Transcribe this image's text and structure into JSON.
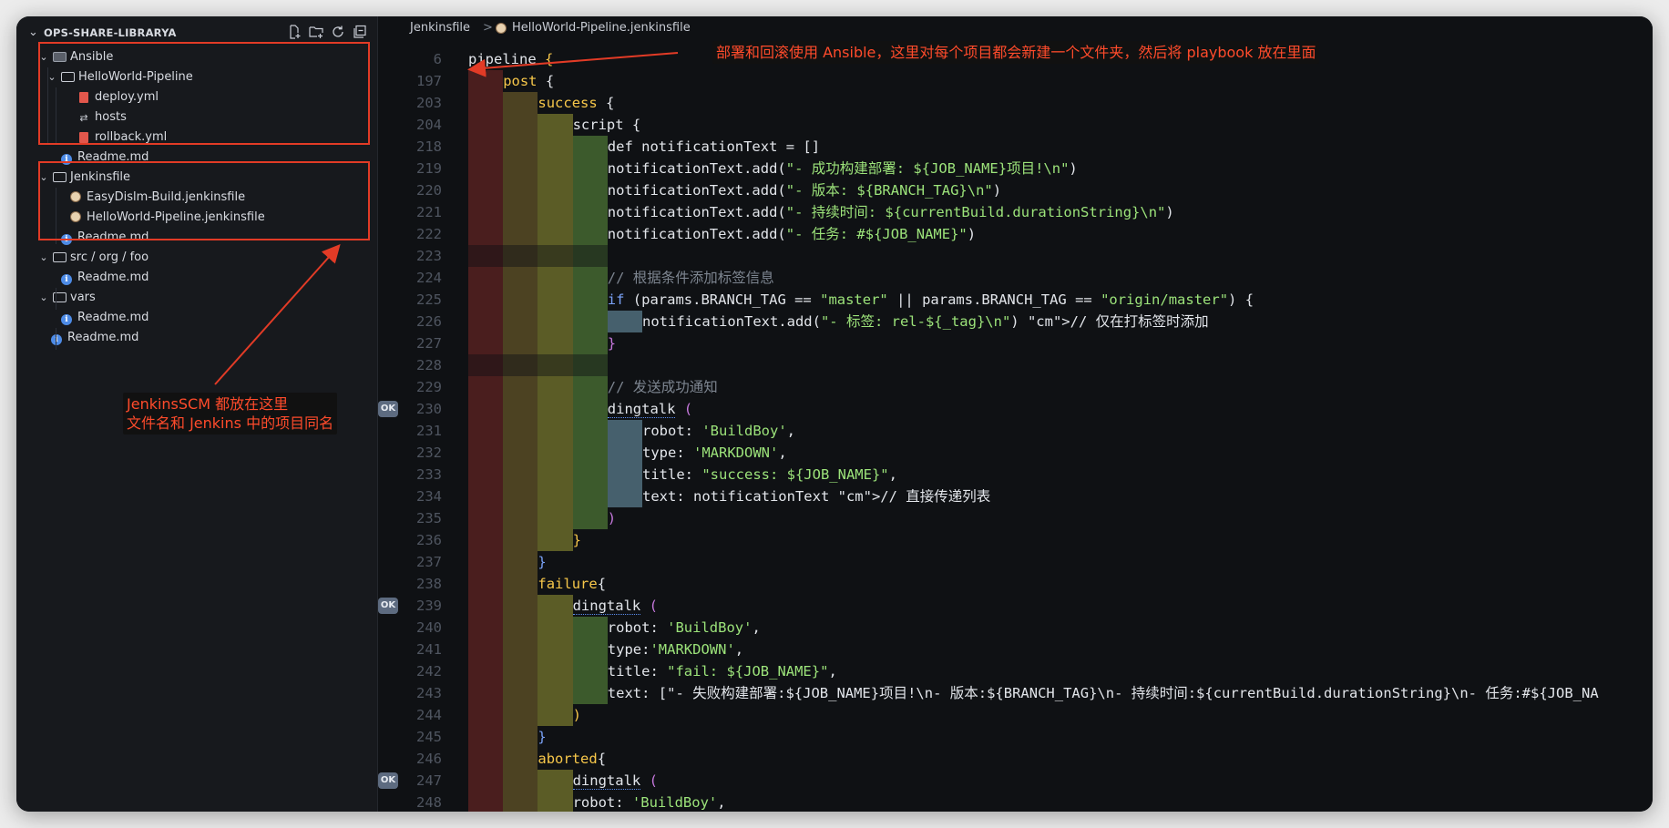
{
  "sidebar": {
    "title": "OPS-SHARE-LIBRARYA",
    "items": [
      {
        "label": "Ansible",
        "depth": 0,
        "kind": "folder-ansible",
        "expanded": true
      },
      {
        "label": "HelloWorld-Pipeline",
        "depth": 1,
        "kind": "folder",
        "expanded": true
      },
      {
        "label": "deploy.yml",
        "depth": 2,
        "kind": "yml"
      },
      {
        "label": "hosts",
        "depth": 2,
        "kind": "hosts"
      },
      {
        "label": "rollback.yml",
        "depth": 2,
        "kind": "yml"
      },
      {
        "label": "Readme.md",
        "depth": 1,
        "kind": "info"
      },
      {
        "label": "Jenkinsfile",
        "depth": 0,
        "kind": "folder",
        "expanded": true
      },
      {
        "label": "EasyDislm-Build.jenkinsfile",
        "depth": 1,
        "kind": "jenkins"
      },
      {
        "label": "HelloWorld-Pipeline.jenkinsfile",
        "depth": 1,
        "kind": "jenkins"
      },
      {
        "label": "Readme.md",
        "depth": 1,
        "kind": "info"
      },
      {
        "label": "src / org / foo",
        "depth": 0,
        "kind": "folder",
        "expanded": true
      },
      {
        "label": "Readme.md",
        "depth": 1,
        "kind": "info"
      },
      {
        "label": "vars",
        "depth": 0,
        "kind": "folder",
        "expanded": true
      },
      {
        "label": "Readme.md",
        "depth": 1,
        "kind": "info"
      },
      {
        "label": "Readme.md",
        "depth": 0,
        "kind": "info"
      }
    ]
  },
  "breadcrumb": {
    "folder": "Jenkinsfile",
    "separator": ">",
    "file": "HelloWorld-Pipeline.jenkinsfile"
  },
  "annotations": {
    "top": "部署和回滚使用 Ansible，这里对每个项目都会新建一个文件夹，然后将 playbook 放在里面",
    "left_line1": "JenkinsSCM 都放在这里",
    "left_line2": "文件名和 Jenkins 中的项目同名",
    "color": "#e23b26"
  },
  "code": {
    "ok_label": "OK",
    "lines": [
      {
        "n": "6",
        "indent": 0,
        "t": "pipeline {",
        "cls": "pipeline"
      },
      {
        "n": "197",
        "indent": 1,
        "t": "post {",
        "cls": "kw"
      },
      {
        "n": "203",
        "indent": 2,
        "t": "success {",
        "cls": "kw"
      },
      {
        "n": "204",
        "indent": 3,
        "t": "script {",
        "cls": "plain"
      },
      {
        "n": "218",
        "indent": 4,
        "t": "def notificationText = []",
        "cls": "plain"
      },
      {
        "n": "219",
        "indent": 4,
        "t": "notificationText.add(\"- 成功构建部署: ${JOB_NAME}项目!\\n\")",
        "cls": "add"
      },
      {
        "n": "220",
        "indent": 4,
        "t": "notificationText.add(\"- 版本: ${BRANCH_TAG}\\n\")",
        "cls": "add"
      },
      {
        "n": "221",
        "indent": 4,
        "t": "notificationText.add(\"- 持续时间: ${currentBuild.durationString}\\n\")",
        "cls": "add"
      },
      {
        "n": "222",
        "indent": 4,
        "t": "notificationText.add(\"- 任务: #${JOB_NAME}\")",
        "cls": "add"
      },
      {
        "n": "223",
        "indent": 4,
        "t": "",
        "cls": "plain"
      },
      {
        "n": "224",
        "indent": 4,
        "t": "// 根据条件添加标签信息",
        "cls": "cm"
      },
      {
        "n": "225",
        "indent": 4,
        "t": "if (params.BRANCH_TAG == \"master\" || params.BRANCH_TAG == \"origin/master\") {",
        "cls": "if"
      },
      {
        "n": "226",
        "indent": 5,
        "t": "notificationText.add(\"- 标签: rel-${_tag}\\n\") // 仅在打标签时添加",
        "cls": "tag"
      },
      {
        "n": "227",
        "indent": 4,
        "t": "}",
        "cls": "br"
      },
      {
        "n": "228",
        "indent": 4,
        "t": "",
        "cls": "plain"
      },
      {
        "n": "229",
        "indent": 4,
        "t": "// 发送成功通知",
        "cls": "cm"
      },
      {
        "n": "230",
        "indent": 4,
        "t": "dingtalk (",
        "cls": "ding",
        "ok": true
      },
      {
        "n": "231",
        "indent": 5,
        "t": "robot: 'BuildBoy',",
        "cls": "kv"
      },
      {
        "n": "232",
        "indent": 5,
        "t": "type: 'MARKDOWN',",
        "cls": "kv"
      },
      {
        "n": "233",
        "indent": 5,
        "t": "title: \"success: ${JOB_NAME}\",",
        "cls": "kv"
      },
      {
        "n": "234",
        "indent": 5,
        "t": "text: notificationText // 直接传递列表",
        "cls": "textc"
      },
      {
        "n": "235",
        "indent": 4,
        "t": ")",
        "cls": "br"
      },
      {
        "n": "236",
        "indent": 3,
        "t": "}",
        "cls": "kw"
      },
      {
        "n": "237",
        "indent": 2,
        "t": "}",
        "cls": "br2"
      },
      {
        "n": "238",
        "indent": 2,
        "t": "failure{",
        "cls": "kw"
      },
      {
        "n": "239",
        "indent": 3,
        "t": "dingtalk (",
        "cls": "ding",
        "ok": true
      },
      {
        "n": "240",
        "indent": 4,
        "t": "robot: 'BuildBoy',",
        "cls": "kv"
      },
      {
        "n": "241",
        "indent": 4,
        "t": "type:'MARKDOWN',",
        "cls": "kv"
      },
      {
        "n": "242",
        "indent": 4,
        "t": "title: \"fail: ${JOB_NAME}\",",
        "cls": "kv"
      },
      {
        "n": "243",
        "indent": 4,
        "t": "text: [\"- 失败构建部署:${JOB_NAME}项目!\\n- 版本:${BRANCH_TAG}\\n- 持续时间:${currentBuild.durationString}\\n- 任务:#${JOB_NA",
        "cls": "kv"
      },
      {
        "n": "244",
        "indent": 3,
        "t": ")",
        "cls": "kw"
      },
      {
        "n": "245",
        "indent": 2,
        "t": "}",
        "cls": "br2"
      },
      {
        "n": "246",
        "indent": 2,
        "t": "aborted{",
        "cls": "kw"
      },
      {
        "n": "247",
        "indent": 3,
        "t": "dingtalk (",
        "cls": "ding",
        "ok": true
      },
      {
        "n": "248",
        "indent": 3,
        "t": "robot: 'BuildBoy',",
        "cls": "kv"
      }
    ]
  }
}
